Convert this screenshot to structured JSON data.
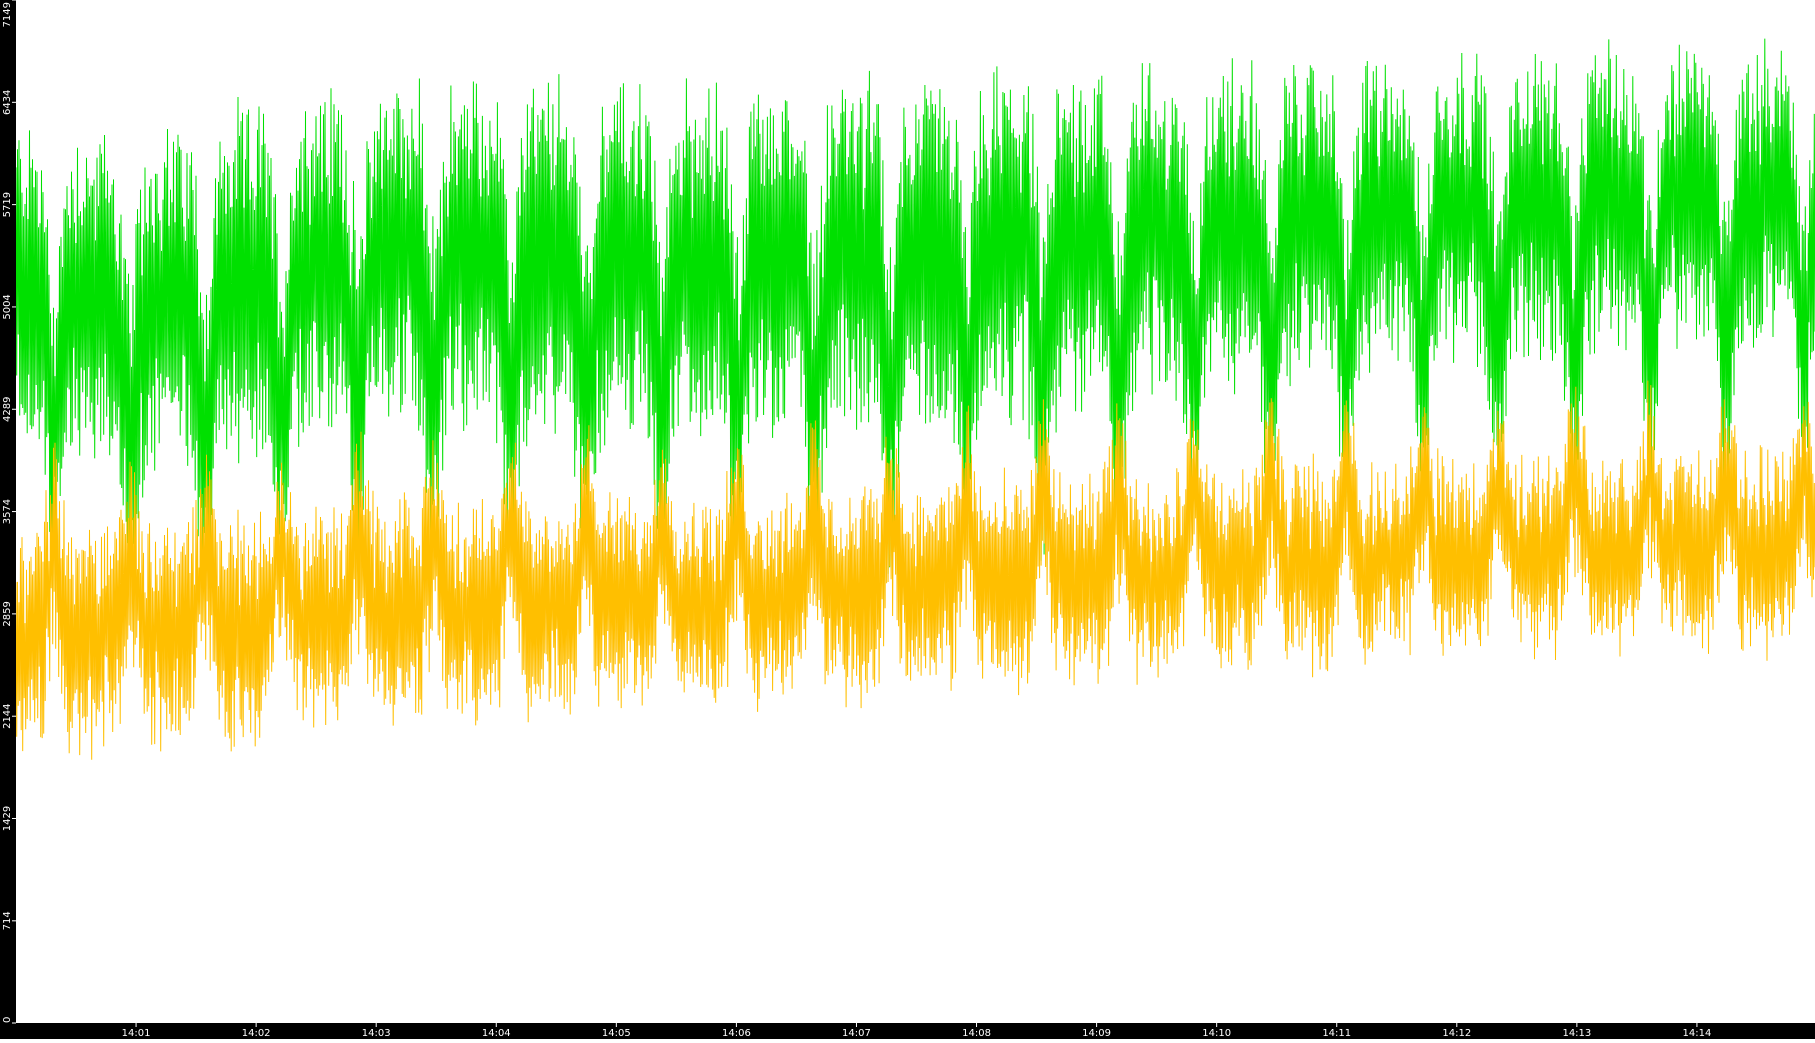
{
  "chart_data": {
    "type": "line",
    "title": "",
    "xlabel": "",
    "ylabel": "",
    "y_ticks": [
      0,
      714,
      1429,
      2144,
      2859,
      3574,
      4289,
      5004,
      5719,
      6434,
      7149
    ],
    "ylim": [
      0,
      7149
    ],
    "x_ticks": [
      "14:01",
      "14:02",
      "14:03",
      "14:04",
      "14:05",
      "14:06",
      "14:07",
      "14:08",
      "14:09",
      "14:10",
      "14:11",
      "14:12",
      "14:13",
      "14:14"
    ],
    "xlim": [
      "14:00:00",
      "14:14:59"
    ],
    "grid": false,
    "legend": "none",
    "background": "#ffffff",
    "axis_strip_color": "#000000",
    "axis_text_color": "#ffffff",
    "series": [
      {
        "color": "#00e000",
        "trend": [
          {
            "t": "14:00:00",
            "mean": 5200,
            "spread": 1200
          },
          {
            "t": "14:01:00",
            "mean": 5000,
            "spread": 1300
          },
          {
            "t": "14:03:00",
            "mean": 5400,
            "spread": 1300
          },
          {
            "t": "14:06:00",
            "mean": 5300,
            "spread": 1350
          },
          {
            "t": "14:09:00",
            "mean": 5500,
            "spread": 1250
          },
          {
            "t": "14:12:00",
            "mean": 5700,
            "spread": 1150
          },
          {
            "t": "14:14:59",
            "mean": 5800,
            "spread": 1100
          }
        ],
        "dip_amplitude": 1000,
        "dip_period_seconds": 38
      },
      {
        "color": "#ffbf00",
        "trend": [
          {
            "t": "14:00:00",
            "mean": 2650,
            "spread": 850
          },
          {
            "t": "14:03:00",
            "mean": 2850,
            "spread": 800
          },
          {
            "t": "14:06:00",
            "mean": 2950,
            "spread": 750
          },
          {
            "t": "14:09:00",
            "mean": 3100,
            "spread": 750
          },
          {
            "t": "14:12:00",
            "mean": 3250,
            "spread": 700
          },
          {
            "t": "14:14:59",
            "mean": 3300,
            "spread": 700
          }
        ],
        "peak_amplitude": 550,
        "peak_period_seconds": 38
      }
    ]
  }
}
